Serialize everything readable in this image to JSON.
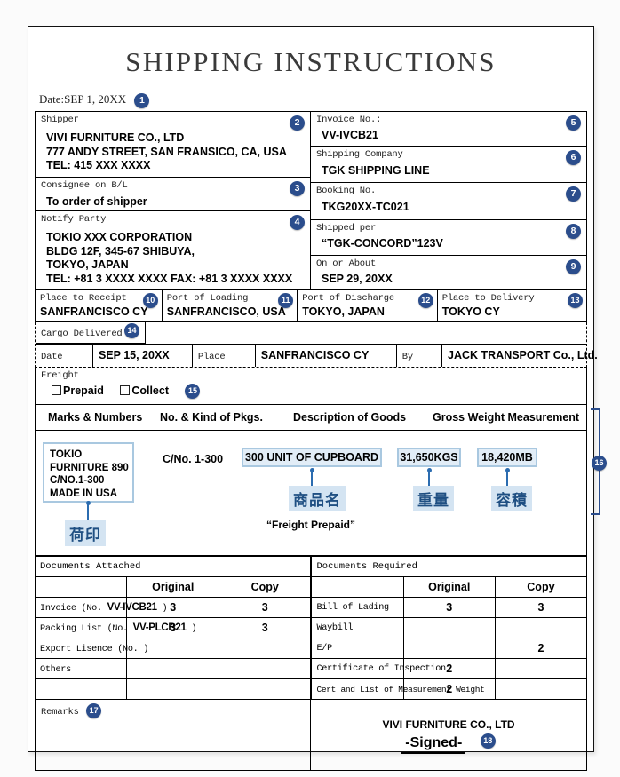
{
  "document": {
    "title": "SHIPPING INSTRUCTIONS",
    "date_line": "Date:SEP 1, 20XX"
  },
  "badges": {
    "b1": "1",
    "b2": "2",
    "b3": "3",
    "b4": "4",
    "b5": "5",
    "b6": "6",
    "b7": "7",
    "b8": "8",
    "b9": "9",
    "b10": "10",
    "b11": "11",
    "b12": "12",
    "b13": "13",
    "b14": "14",
    "b15": "15",
    "b16": "16",
    "b17": "17",
    "b18": "18"
  },
  "shipper": {
    "label": "Shipper",
    "line1": "VIVI FURNITURE CO., LTD",
    "line2": "777 ANDY STREET, SAN FRANSICO, CA, USA",
    "line3": "TEL: 415 XXX XXXX"
  },
  "consignee": {
    "label": "Consignee on B/L",
    "value": "To order of shipper"
  },
  "notify": {
    "label": "Notify Party",
    "line1": "TOKIO XXX CORPORATION",
    "line2": "BLDG 12F, 345-67 SHIBUYA,",
    "line3": "TOKYO, JAPAN",
    "line4": "TEL: +81 3 XXXX XXXX FAX: +81 3 XXXX XXXX"
  },
  "invoice": {
    "label": "Invoice No.:",
    "value": "VV-IVCB21"
  },
  "shipping_company": {
    "label": "Shipping Company",
    "value": "TGK SHIPPING LINE"
  },
  "booking": {
    "label": "Booking No.",
    "value": "TKG20XX-TC021"
  },
  "shipped_per": {
    "label": "Shipped per",
    "value": "“TGK-CONCORD”123V"
  },
  "on_or_about": {
    "label": "On or About",
    "value": "SEP 29, 20XX"
  },
  "ports": [
    {
      "label": "Place to Receipt",
      "value": "SANFRANCISCO CY"
    },
    {
      "label": "Port of Loading",
      "value": "SANFRANCISCO, USA"
    },
    {
      "label": "Port of Discharge",
      "value": "TOKYO, JAPAN"
    },
    {
      "label": "Place to Delivery",
      "value": "TOKYO CY"
    }
  ],
  "cargo_delivered": {
    "title": "Cargo Delivered",
    "date_label": "Date",
    "date_value": "SEP 15, 20XX",
    "place_label": "Place",
    "place_value": "SANFRANCISCO CY",
    "by_label": "By",
    "by_value": "JACK TRANSPORT Co., Ltd."
  },
  "freight": {
    "label": "Freight",
    "prepaid": "Prepaid",
    "collect": "Collect"
  },
  "cargo": {
    "headers": {
      "marks": "Marks & Numbers",
      "pkgs": "No. & Kind of Pkgs.",
      "description": "Description of Goods",
      "gross": "Gross Weight Measurement"
    },
    "marks_lines": [
      "TOKIO",
      "FURNITURE 890",
      "C/NO.1-300",
      "MADE IN USA"
    ],
    "marks_annotation": "荷印",
    "pkgs_value": "C/No. 1-300",
    "description_value": "300 UNIT OF CUPBOARD",
    "description_annotation": "商品名",
    "weight_value": "31,650KGS",
    "weight_annotation": "重量",
    "measurement_value": "18,420MB",
    "measurement_annotation": "容積",
    "freight_note": "“Freight Prepaid”"
  },
  "documents_attached": {
    "title": "Documents Attached",
    "col_original": "Original",
    "col_copy": "Copy",
    "rows": [
      {
        "name_pre": "Invoice (No. ",
        "name_bold": "VV-IVCB21",
        "name_post": " )",
        "original": "3",
        "copy": "3"
      },
      {
        "name_pre": "Packing List (No. ",
        "name_bold": "VV-PLCB21",
        "name_post": " )",
        "original": "3",
        "copy": "3"
      },
      {
        "name_pre": "Export Lisence (No.",
        "name_bold": "",
        "name_post": "            )",
        "original": "",
        "copy": ""
      },
      {
        "name_pre": "Others",
        "name_bold": "",
        "name_post": "",
        "original": "",
        "copy": ""
      },
      {
        "name_pre": "",
        "name_bold": "",
        "name_post": "",
        "original": "",
        "copy": ""
      }
    ]
  },
  "documents_required": {
    "title": "Documents Required",
    "col_original": "Original",
    "col_copy": "Copy",
    "rows": [
      {
        "name": "Bill of Lading",
        "original": "3",
        "copy": "3"
      },
      {
        "name": "Waybill",
        "original": "",
        "copy": ""
      },
      {
        "name": "E/P",
        "original": "",
        "copy": "2"
      },
      {
        "name": "Certificate of Inspection",
        "original": "2",
        "copy": ""
      },
      {
        "name": "Cert and List of Measurement  Weight",
        "original": "2",
        "copy": ""
      }
    ]
  },
  "remarks": {
    "label": "Remarks"
  },
  "signature": {
    "company": "VIVI FURNITURE CO., LTD",
    "signed": "-Signed-"
  }
}
